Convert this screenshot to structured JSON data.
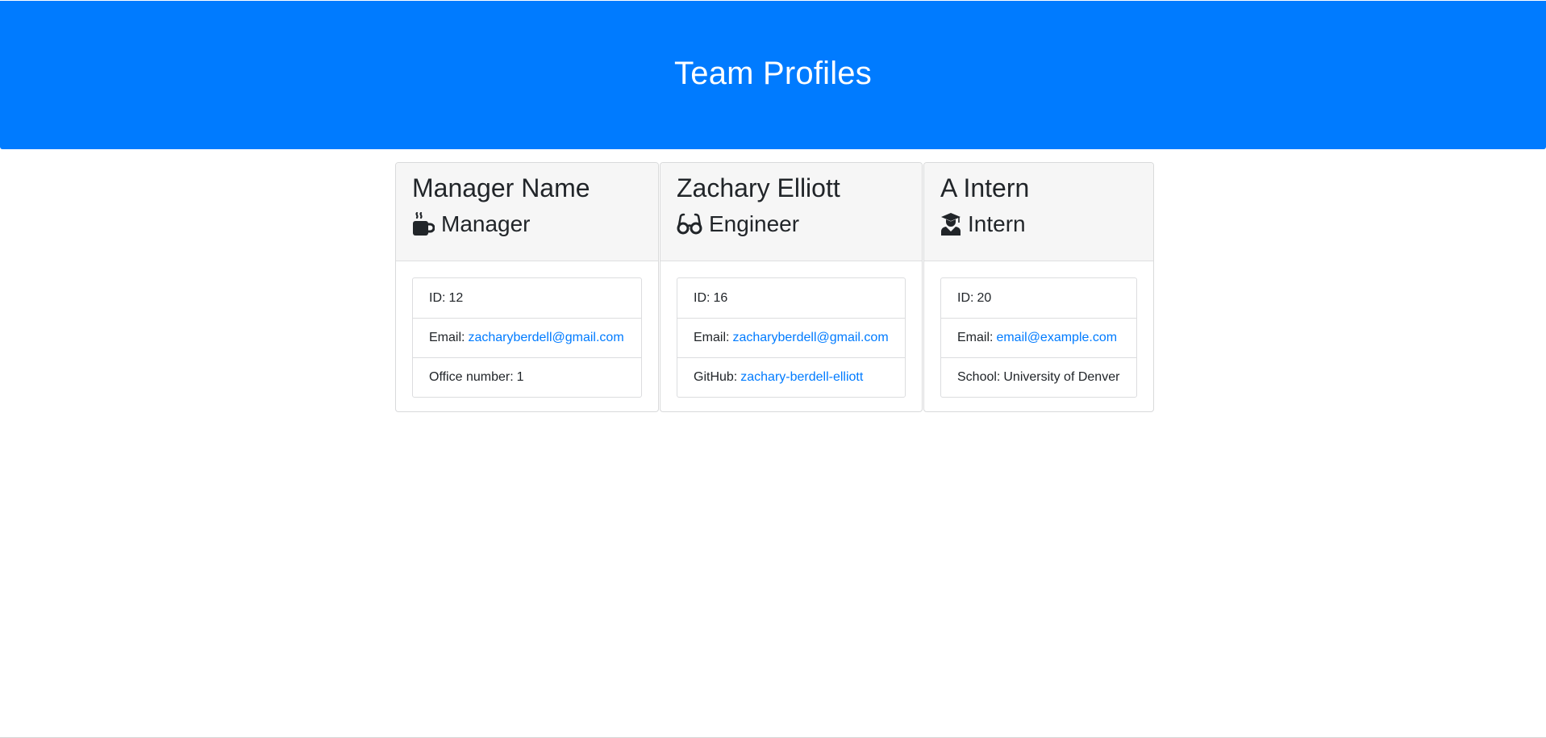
{
  "header": {
    "title": "Team Profiles",
    "background": "#007bff"
  },
  "cards": [
    {
      "name": "Manager Name",
      "role": "Manager",
      "role_icon": "coffee-mug-icon",
      "id_label": "ID:",
      "id_value": "12",
      "email_label": "Email:",
      "email_value": "zacharyberdell@gmail.com",
      "extra_label": "Office number:",
      "extra_value": "1"
    },
    {
      "name": "Zachary Elliott",
      "role": "Engineer",
      "role_icon": "glasses-icon",
      "id_label": "ID:",
      "id_value": "16",
      "email_label": "Email:",
      "email_value": "zacharyberdell@gmail.com",
      "extra_label": "GitHub:",
      "extra_value": "zachary-berdell-elliott"
    },
    {
      "name": "A Intern",
      "role": "Intern",
      "role_icon": "graduate-icon",
      "id_label": "ID:",
      "id_value": "20",
      "email_label": "Email:",
      "email_value": "email@example.com",
      "extra_label": "School:",
      "extra_value": "University of Denver"
    }
  ],
  "colors": {
    "link": "#007bff",
    "card_header_bg": "#f6f6f6",
    "text": "#212529"
  }
}
